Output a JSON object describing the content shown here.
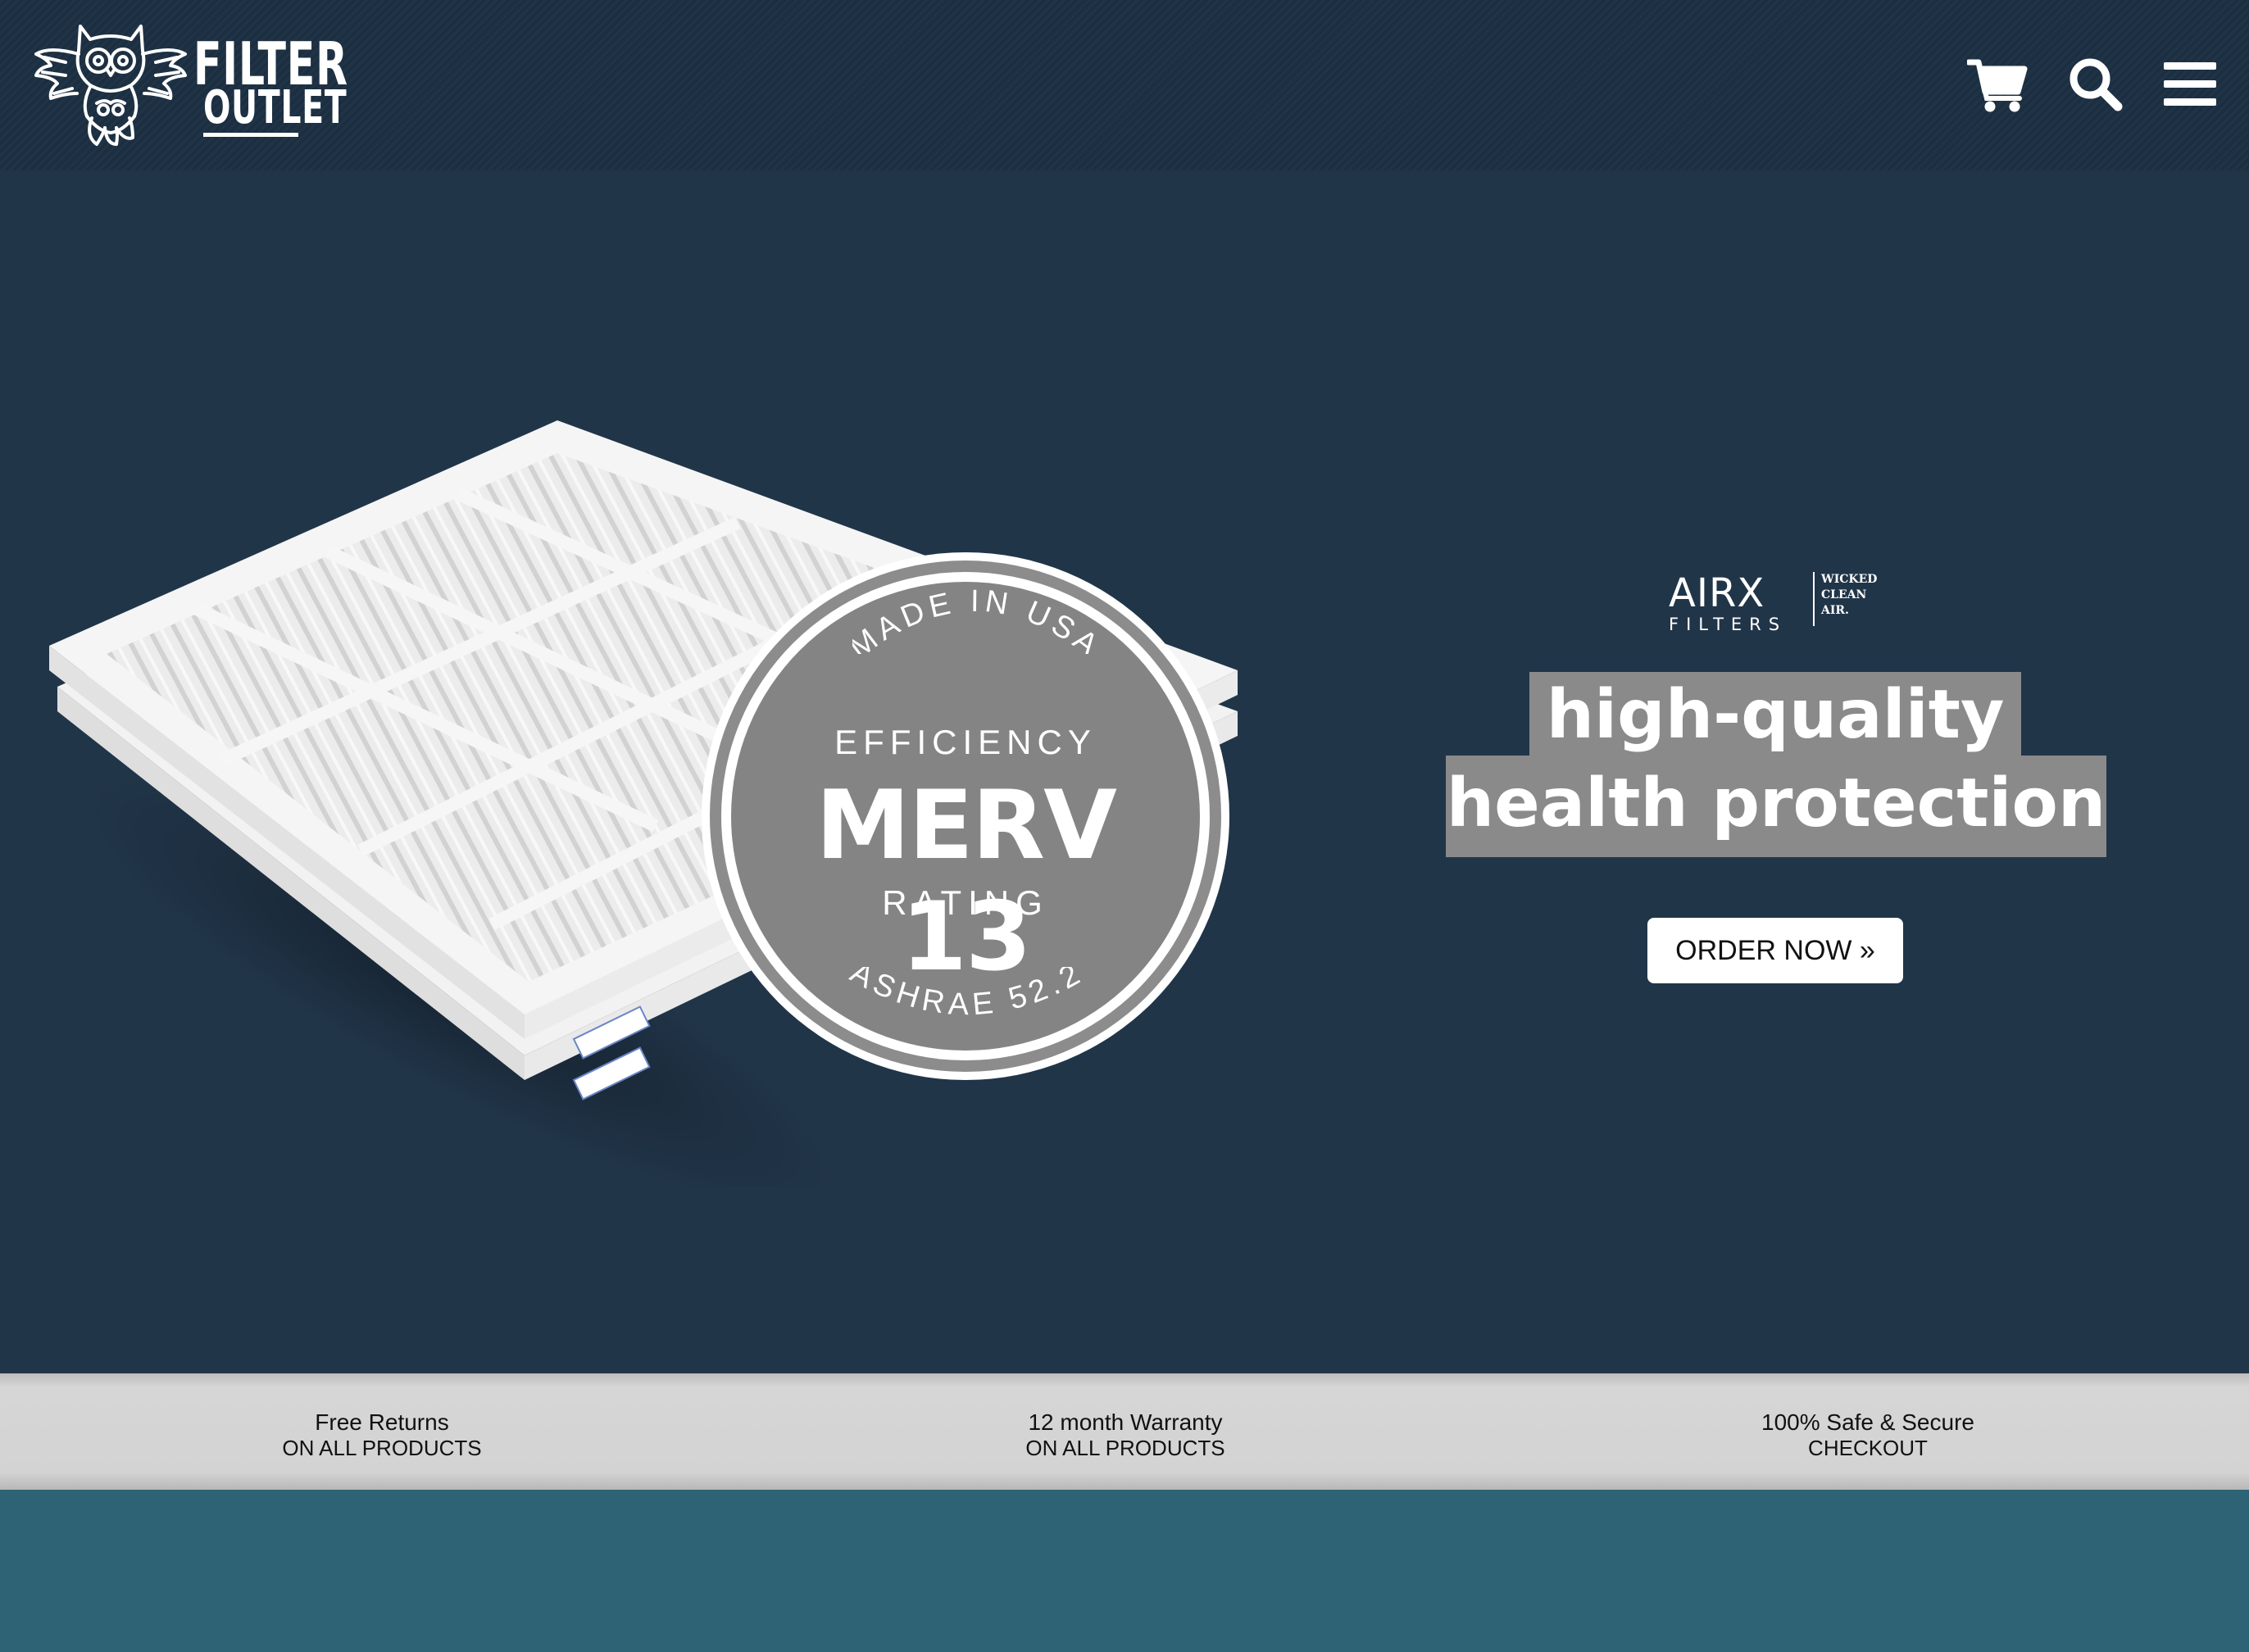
{
  "header": {
    "brand_line1": "FILTER",
    "brand_line2": "OUTLET",
    "icons": [
      "cart-icon",
      "search-icon",
      "menu-icon"
    ]
  },
  "hero": {
    "badge": {
      "top_arc": "MADE IN USA",
      "line1": "EFFICIENCY",
      "line2": "MERV 13",
      "line3": "RATING",
      "bottom_arc": "ASHRAE 52.2"
    },
    "airx_logo": {
      "main": "AIRX",
      "sub": "FILTERS",
      "tagline": [
        "WICKED",
        "CLEAN",
        "AIR."
      ]
    },
    "headline_line1": "high-quality",
    "headline_line2": "health protection",
    "cta_label": "ORDER NOW »"
  },
  "trust_bar": [
    {
      "title": "Free Returns",
      "subtitle": "ON ALL PRODUCTS"
    },
    {
      "title": "12 month Warranty",
      "subtitle": "ON ALL PRODUCTS"
    },
    {
      "title": "100% Safe & Secure",
      "subtitle": "CHECKOUT"
    }
  ],
  "colors": {
    "header_bg": "#1c2f42",
    "hero_bg": "#213549",
    "badge_gray": "#848484",
    "trust_bar_bg": "#d3d3d3",
    "footer_band": "#2e6275"
  }
}
